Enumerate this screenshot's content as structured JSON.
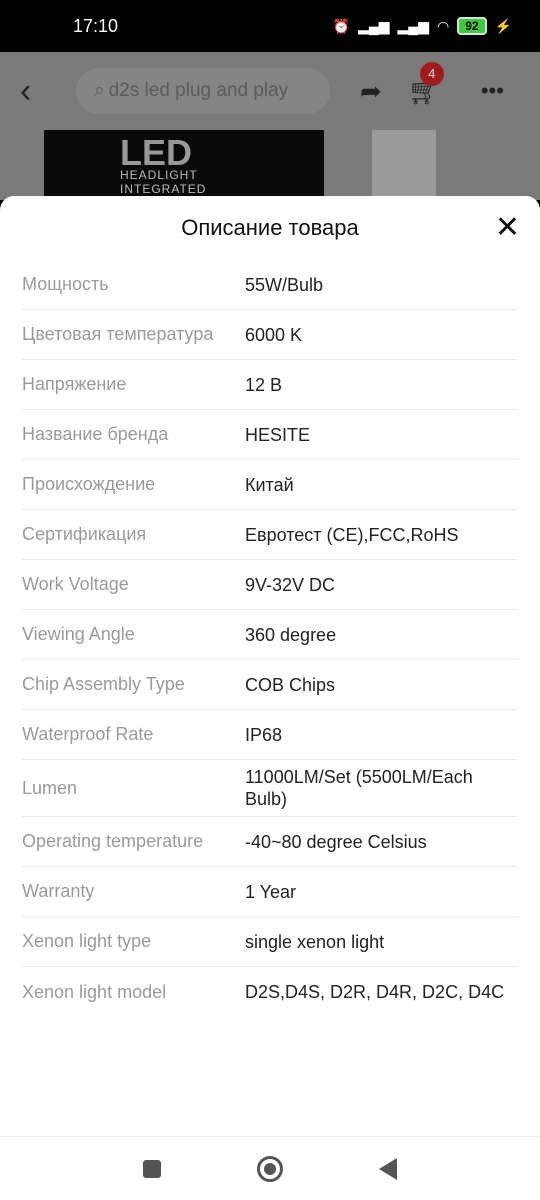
{
  "status": {
    "time": "17:10",
    "battery": "92"
  },
  "topbar": {
    "search_placeholder": "d2s led plug and play",
    "cart_count": "4"
  },
  "product_image": {
    "text1": "LED",
    "text2": "HEADLIGHT",
    "text3": "INTEGRATED"
  },
  "sheet": {
    "title": "Описание товара",
    "specs": [
      {
        "k": "Мощность",
        "v": "55W/Bulb"
      },
      {
        "k": "Цветовая температура",
        "v": "6000 K"
      },
      {
        "k": "Напряжение",
        "v": "12 В"
      },
      {
        "k": "Название бренда",
        "v": "HESITE"
      },
      {
        "k": "Происхождение",
        "v": "Китай"
      },
      {
        "k": "Сертификация",
        "v": "Евротест (CE),FCC,RoHS"
      },
      {
        "k": "Work Voltage",
        "v": "9V-32V DC"
      },
      {
        "k": "Viewing Angle",
        "v": "360 degree"
      },
      {
        "k": "Chip Assembly Type",
        "v": "COB Chips"
      },
      {
        "k": "Waterproof Rate",
        "v": "IP68"
      },
      {
        "k": "Lumen",
        "v": "11000LM/Set (5500LM/Each Bulb)"
      },
      {
        "k": "Operating temperature",
        "v": "-40~80 degree Celsius"
      },
      {
        "k": "Warranty",
        "v": "1 Year"
      },
      {
        "k": "Xenon light type",
        "v": "single xenon light"
      },
      {
        "k": "Xenon light model",
        "v": "D2S,D4S, D2R, D4R, D2C, D4C"
      }
    ]
  }
}
